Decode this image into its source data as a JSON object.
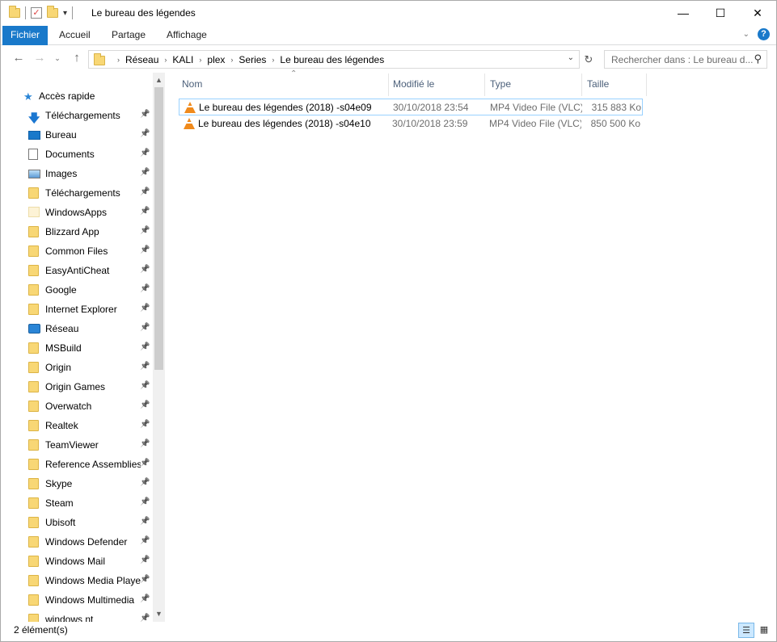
{
  "window": {
    "title": "Le bureau des légendes",
    "controls": [
      "—",
      "☐",
      "✕"
    ]
  },
  "ribbon": {
    "tabs": [
      "Fichier",
      "Accueil",
      "Partage",
      "Affichage"
    ],
    "help": "?"
  },
  "address": {
    "crumbs": [
      "Réseau",
      "KALI",
      "plex",
      "Series",
      "Le bureau des légendes"
    ],
    "search_placeholder": "Rechercher dans : Le bureau d..."
  },
  "sidebar": {
    "quick_access": "Accès rapide",
    "items": [
      {
        "label": "Téléchargements",
        "icon": "download-arrow-icon"
      },
      {
        "label": "Bureau",
        "icon": "desktop-icon"
      },
      {
        "label": "Documents",
        "icon": "documents-icon"
      },
      {
        "label": "Images",
        "icon": "pictures-icon"
      },
      {
        "label": "Téléchargements",
        "icon": "folder-icon"
      },
      {
        "label": "WindowsApps",
        "icon": "light-folder-icon"
      },
      {
        "label": "Blizzard App",
        "icon": "folder-icon"
      },
      {
        "label": "Common Files",
        "icon": "folder-icon"
      },
      {
        "label": "EasyAntiCheat",
        "icon": "folder-icon"
      },
      {
        "label": "Google",
        "icon": "folder-icon"
      },
      {
        "label": "Internet Explorer",
        "icon": "folder-icon"
      },
      {
        "label": "Réseau",
        "icon": "network-icon"
      },
      {
        "label": "MSBuild",
        "icon": "folder-icon"
      },
      {
        "label": "Origin",
        "icon": "folder-icon"
      },
      {
        "label": "Origin Games",
        "icon": "folder-icon"
      },
      {
        "label": "Overwatch",
        "icon": "folder-icon"
      },
      {
        "label": "Realtek",
        "icon": "folder-icon"
      },
      {
        "label": "TeamViewer",
        "icon": "folder-icon"
      },
      {
        "label": "Reference Assemblies",
        "icon": "folder-icon"
      },
      {
        "label": "Skype",
        "icon": "folder-icon"
      },
      {
        "label": "Steam",
        "icon": "folder-icon"
      },
      {
        "label": "Ubisoft",
        "icon": "folder-icon"
      },
      {
        "label": "Windows Defender",
        "icon": "folder-icon"
      },
      {
        "label": "Windows Mail",
        "icon": "folder-icon"
      },
      {
        "label": "Windows Media Player",
        "icon": "folder-icon"
      },
      {
        "label": "Windows Multimedia",
        "icon": "folder-icon"
      },
      {
        "label": "windows nt",
        "icon": "folder-icon"
      }
    ]
  },
  "columns": {
    "name": "Nom",
    "date": "Modifié le",
    "type": "Type",
    "size": "Taille"
  },
  "files": [
    {
      "name": "Le bureau des légendes (2018) -s04e09",
      "date": "30/10/2018 23:54",
      "type": "MP4 Video File (VLC)",
      "size": "315 883 Ko",
      "selected": true
    },
    {
      "name": "Le bureau des légendes (2018) -s04e10",
      "date": "30/10/2018 23:59",
      "type": "MP4 Video File (VLC)",
      "size": "850 500 Ko",
      "selected": false
    }
  ],
  "status": {
    "count": "2 élément(s)"
  },
  "colors": {
    "file_tab": "#1979ca",
    "selection_border": "#99d1ff",
    "folder": "#f8d775"
  }
}
